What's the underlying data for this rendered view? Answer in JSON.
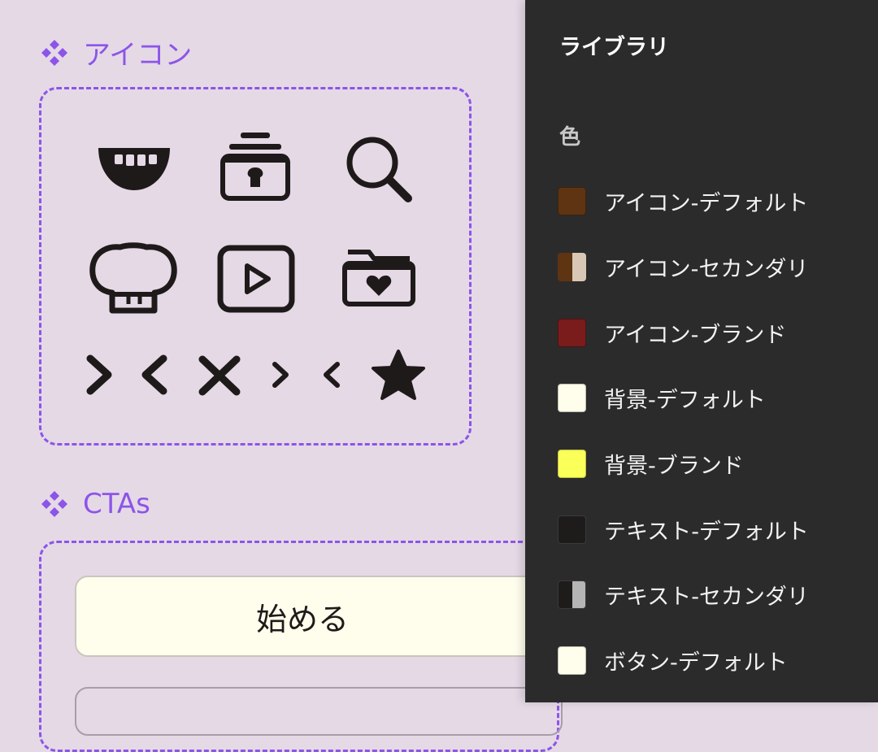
{
  "canvas": {
    "icons_section": {
      "title": "アイコン"
    },
    "ctas_section": {
      "title": "CTAs"
    },
    "cta_button": {
      "label": "始める"
    },
    "icons": [
      "mouth-icon",
      "jar-icon",
      "search-icon",
      "chef-hat-icon",
      "play-icon",
      "folder-heart-icon",
      "chevron-right-icon",
      "chevron-left-icon",
      "close-icon",
      "chevron-right-small-icon",
      "chevron-left-small-icon",
      "star-icon"
    ]
  },
  "library": {
    "title": "ライブラリ",
    "section_label": "色",
    "colors": [
      {
        "name": "アイコン-デフォルト",
        "color": "#5e3413",
        "secondary": null
      },
      {
        "name": "アイコン-セカンダリ",
        "color": "#5e3413",
        "secondary": "#d8c7b5"
      },
      {
        "name": "アイコン-ブランド",
        "color": "#7a1c1c",
        "secondary": null
      },
      {
        "name": "背景-デフォルト",
        "color": "#fffeec",
        "secondary": null
      },
      {
        "name": "背景-ブランド",
        "color": "#fbff5a",
        "secondary": null
      },
      {
        "name": "テキスト-デフォルト",
        "color": "#1e1b1b",
        "secondary": null
      },
      {
        "name": "テキスト-セカンダリ",
        "color": "#1e1b1b",
        "secondary": "#b5b5b5"
      },
      {
        "name": "ボタン-デフォルト",
        "color": "#fffeec",
        "secondary": null
      }
    ]
  },
  "colors": {
    "canvas_bg": "#e5d9e6",
    "accent": "#8c55e8",
    "panel_bg": "#2b2b2b",
    "icon_ink": "#1f1a1a"
  }
}
